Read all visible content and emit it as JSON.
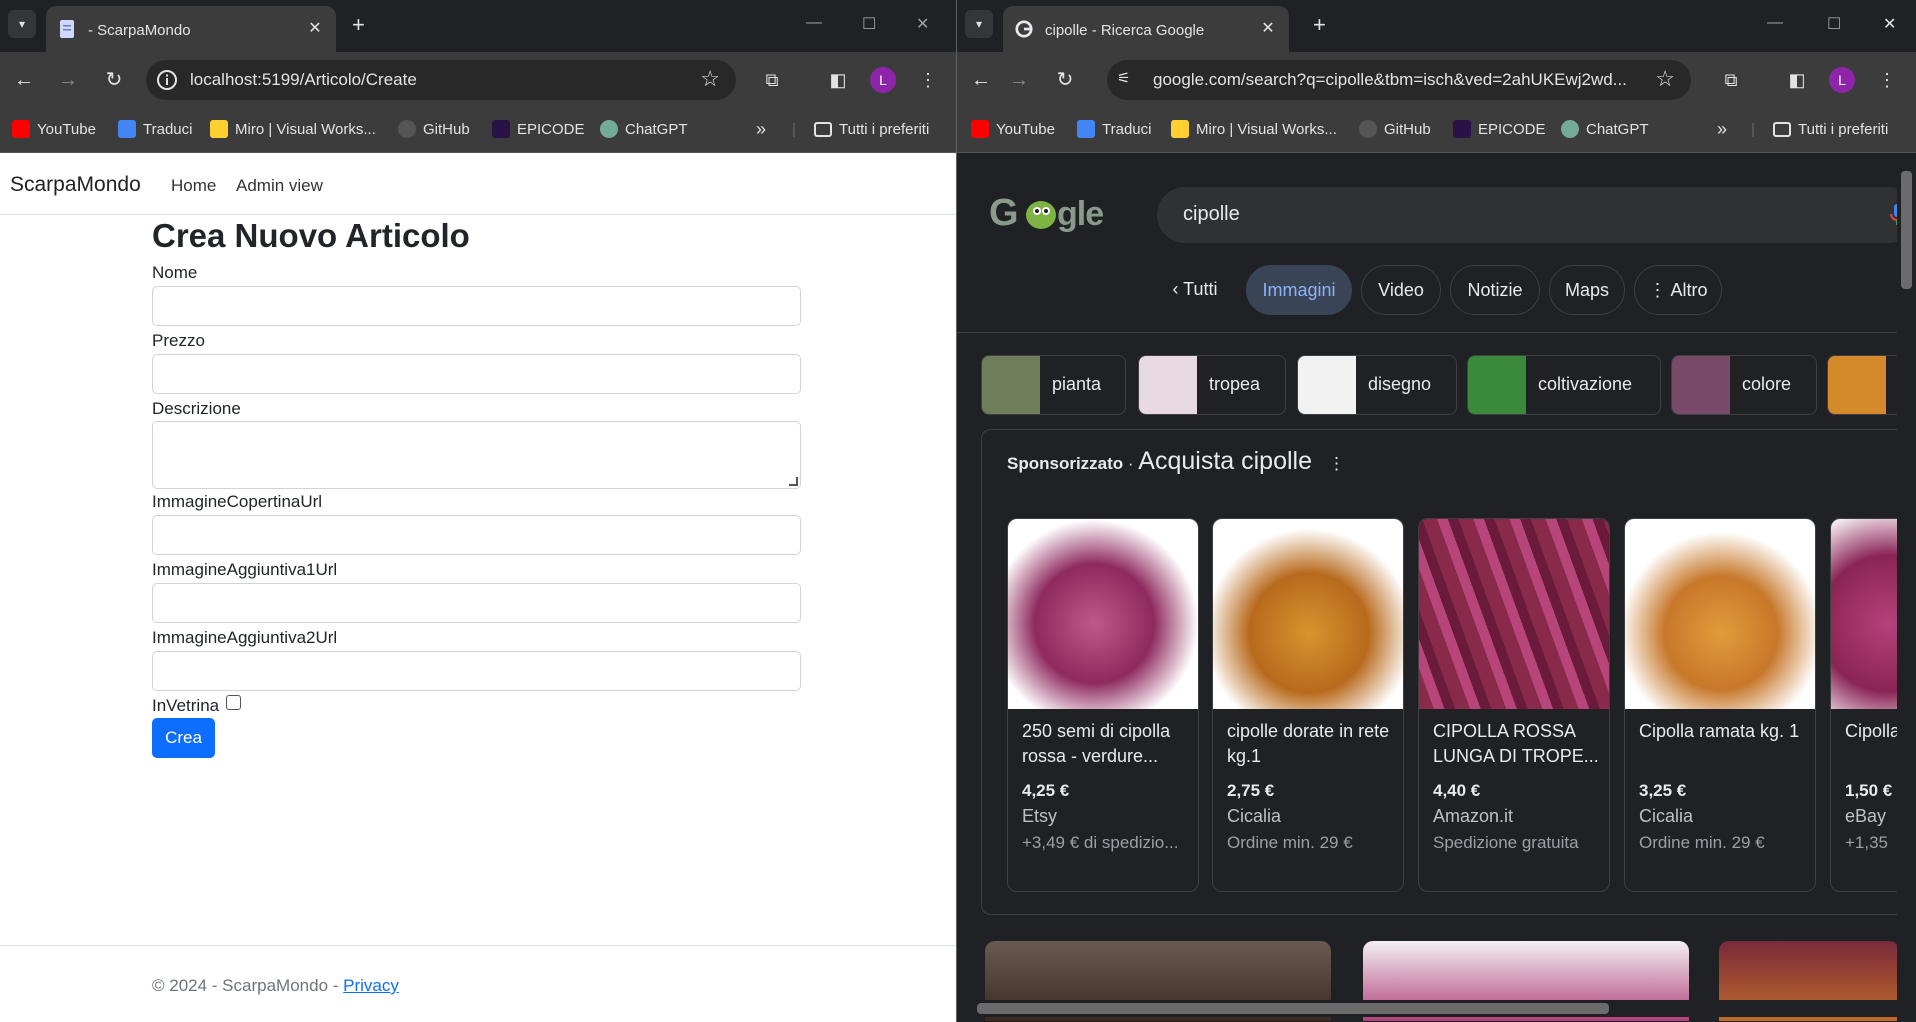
{
  "left_window": {
    "tab_title": "- ScarpaMondo",
    "url": "localhost:5199/Articolo/Create",
    "bookmarks": [
      "YouTube",
      "Traduci",
      "Miro | Visual Works...",
      "GitHub",
      "EPICODE",
      "ChatGPT"
    ],
    "bookmarks_more": "»",
    "all_bookmarks": "Tutti i preferiti",
    "avatar_letter": "L",
    "page": {
      "brand": "ScarpaMondo",
      "nav": [
        "Home",
        "Admin view"
      ],
      "heading": "Crea Nuovo Articolo",
      "fields": [
        "Nome",
        "Prezzo",
        "Descrizione",
        "ImmagineCopertinaUrl",
        "ImmagineAggiuntiva1Url",
        "ImmagineAggiuntiva2Url"
      ],
      "checkbox_label": "InVetrina",
      "submit": "Crea",
      "footer_text": "© 2024 - ScarpaMondo - ",
      "footer_link": "Privacy"
    }
  },
  "right_window": {
    "tab_title": "cipolle - Ricerca Google",
    "url": "google.com/search?q=cipolle&tbm=isch&ved=2ahUKEwj2wd...",
    "bookmarks": [
      "YouTube",
      "Traduci",
      "Miro | Visual Works...",
      "GitHub",
      "EPICODE",
      "ChatGPT"
    ],
    "bookmarks_more": "»",
    "all_bookmarks": "Tutti i preferiti",
    "avatar_letter": "L",
    "page": {
      "query": "cipolle",
      "tabs": [
        "Tutti",
        "Immagini",
        "Video",
        "Notizie",
        "Maps",
        "Altro"
      ],
      "selected_tab": "Immagini",
      "related": [
        "pianta",
        "tropea",
        "disegno",
        "coltivazione",
        "colore"
      ],
      "sponsored_label": "Sponsorizzato",
      "sponsored_sep": " · ",
      "sponsored_title": "Acquista cipolle",
      "products": [
        {
          "title": "250 semi di cipolla rossa - verdure...",
          "price": "4,25 €",
          "shop": "Etsy",
          "extra": "+3,49 € di spedizio..."
        },
        {
          "title": "cipolle dorate in rete kg.1",
          "price": "2,75 €",
          "shop": "Cicalia",
          "extra": "Ordine min. 29 €"
        },
        {
          "title": "CIPOLLA ROSSA LUNGA DI TROPE...",
          "price": "4,40 €",
          "shop": "Amazon.it",
          "extra": "Spedizione gratuita"
        },
        {
          "title": "Cipolla ramata kg. 1",
          "price": "3,25 €",
          "shop": "Cicalia",
          "extra": "Ordine min. 29 €"
        },
        {
          "title": "Cipolla Savon",
          "price": "1,50 €",
          "shop": "eBay",
          "extra": "+1,35"
        }
      ]
    }
  },
  "colors": {
    "primary_button": "#0d6efd",
    "chrome_dark": "#202124",
    "google_selected_chip": "#394457"
  }
}
